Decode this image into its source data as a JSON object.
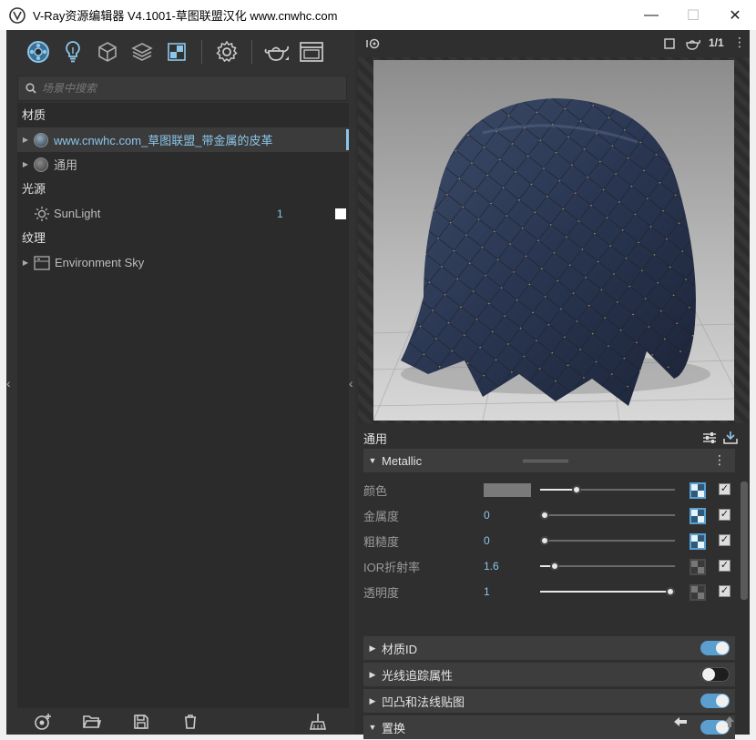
{
  "window": {
    "title": "V-Ray资源编辑器 V4.1001-草图联盟汉化 www.cnwhc.com",
    "minimize_glyph": "—",
    "maximize_glyph": "☐",
    "close_glyph": "✕"
  },
  "toolbar": {
    "icons": [
      "materials-icon",
      "lights-icon",
      "geometry-icon",
      "layers-icon",
      "textures-icon",
      "settings-icon",
      "render-teapot-icon",
      "frame-buffer-icon"
    ]
  },
  "search": {
    "placeholder": "场景中搜索",
    "value": ""
  },
  "tree": {
    "materials_label": "材质",
    "materials": [
      {
        "name": "www.cnwhc.com_草图联盟_带金属的皮革",
        "selected": true
      },
      {
        "name": "通用",
        "selected": false
      }
    ],
    "lights_label": "光源",
    "lights": [
      {
        "name": "SunLight",
        "count": "1"
      }
    ],
    "textures_label": "纹理",
    "textures": [
      {
        "name": "Environment Sky"
      }
    ]
  },
  "preview": {
    "ratio_label": "1/1"
  },
  "props": {
    "header": "通用",
    "metallic_section": "Metallic",
    "rows": [
      {
        "label": "颜色",
        "value": "",
        "fraction": 0.25,
        "tex_active": true
      },
      {
        "label": "金属度",
        "value": "0",
        "fraction": 0.0,
        "tex_active": true
      },
      {
        "label": "粗糙度",
        "value": "0",
        "fraction": 0.0,
        "tex_active": true
      },
      {
        "label": "IOR折射率",
        "value": "1.6",
        "fraction": 0.08,
        "tex_active": false
      },
      {
        "label": "透明度",
        "value": "1",
        "fraction": 1.0,
        "tex_active": false
      }
    ],
    "sections": [
      {
        "label": "材质ID",
        "on": true,
        "expanded": false
      },
      {
        "label": "光线追踪属性",
        "on": false,
        "expanded": false
      },
      {
        "label": "凹凸和法线贴图",
        "on": true,
        "expanded": false
      },
      {
        "label": "置换",
        "on": true,
        "expanded": true
      }
    ]
  },
  "colors": {
    "accent": "#8cc6ea",
    "toggle_on": "#5a9fcf",
    "panel": "#2f2f2f"
  }
}
